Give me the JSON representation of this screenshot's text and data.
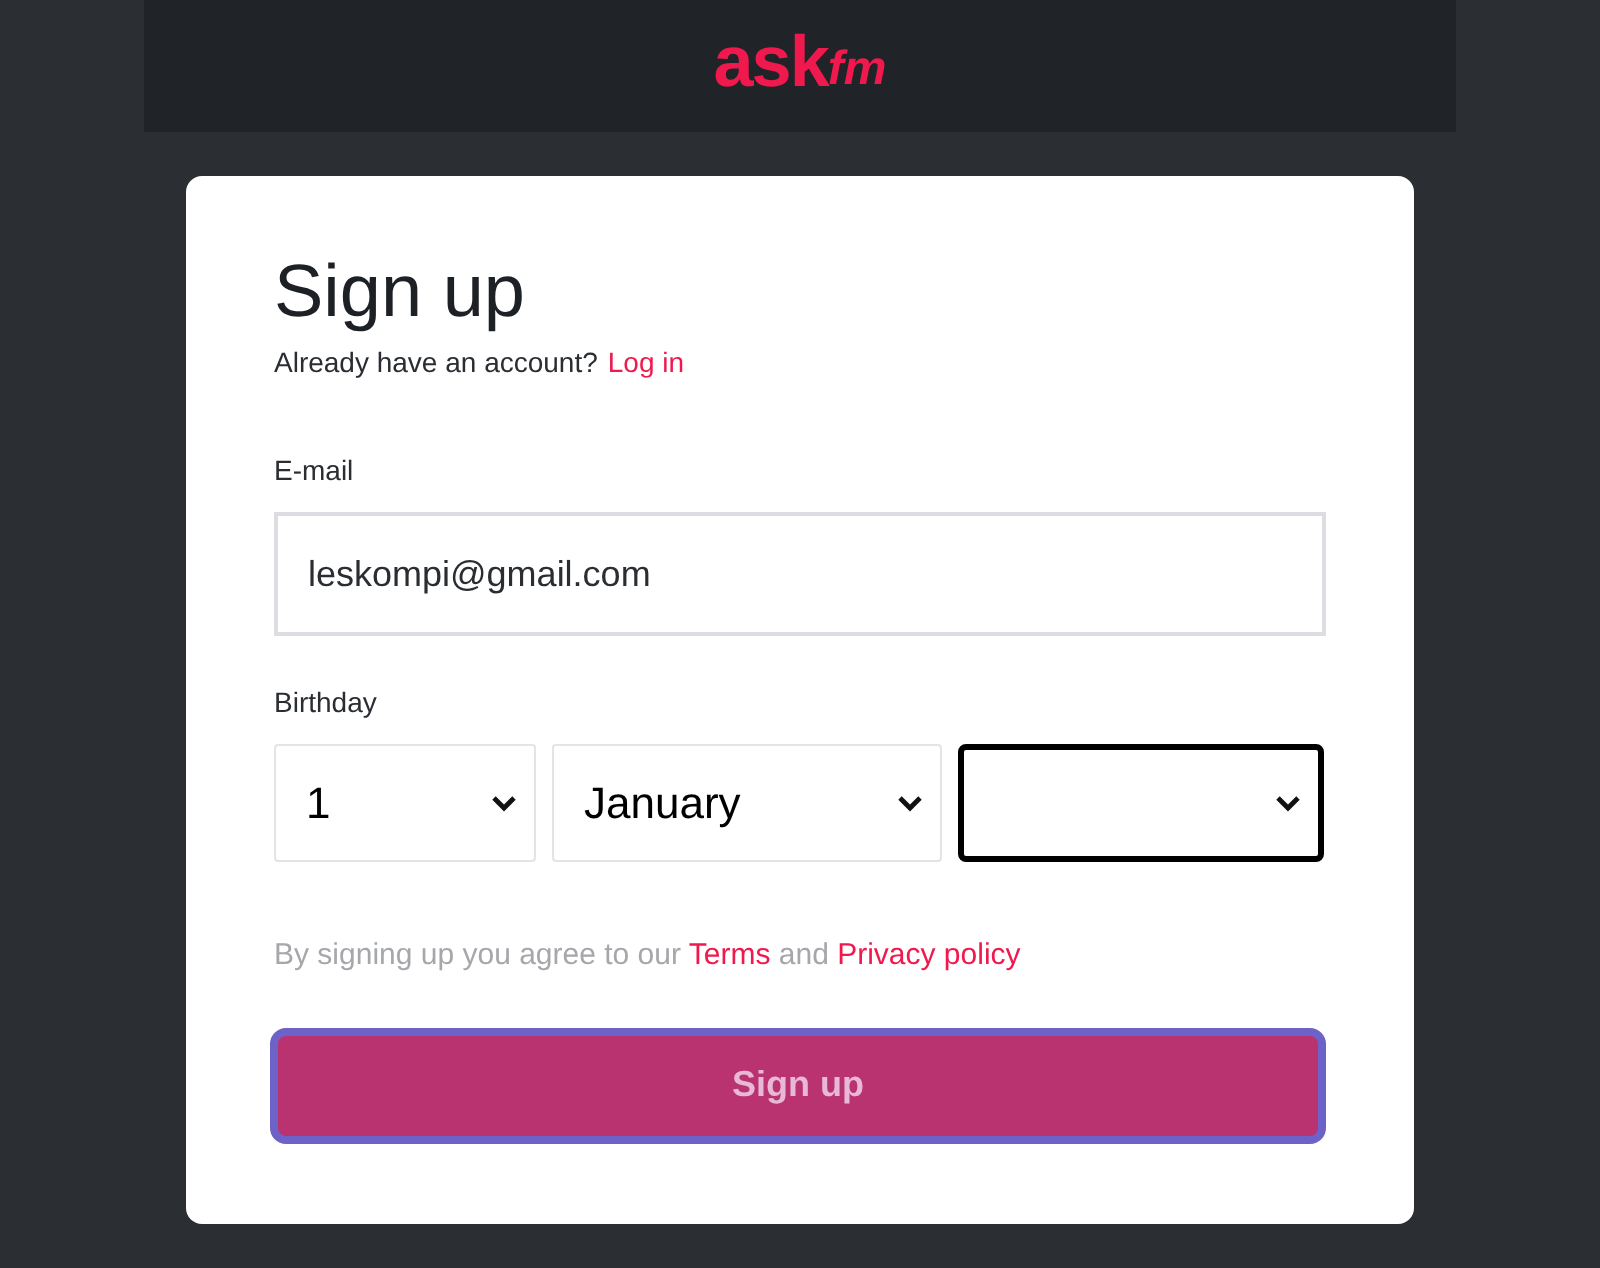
{
  "logo": {
    "main": "ask",
    "suffix": "fm"
  },
  "title": "Sign up",
  "login_prompt": {
    "text": "Already have an account?",
    "link": "Log in"
  },
  "email": {
    "label": "E-mail",
    "value": "leskompi@gmail.com"
  },
  "birthday": {
    "label": "Birthday",
    "selects": [
      {
        "value": "1",
        "focused": false
      },
      {
        "value": "January",
        "focused": false
      },
      {
        "focused": true
      }
    ]
  },
  "agreement": {
    "before": "By signing up you agree to our",
    "terms": "Terms",
    "middle": "and",
    "privacy": "Privacy policy"
  },
  "submit": {
    "label": "Sign up",
    "focused": true
  }
}
